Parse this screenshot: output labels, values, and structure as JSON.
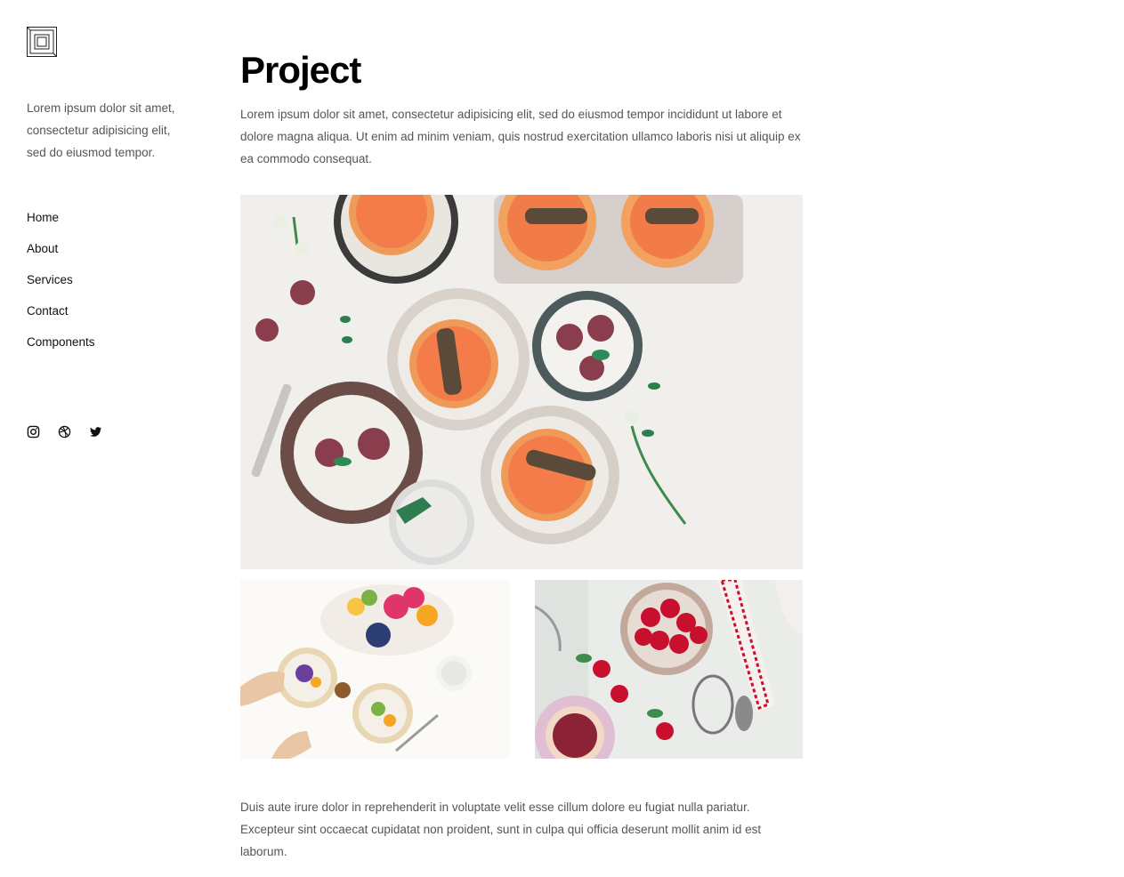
{
  "brand": {
    "logo_icon": "square-frame-logo-icon"
  },
  "sidebar": {
    "description": "Lorem ipsum dolor sit amet, consectetur adipisicing elit, sed do eiusmod tempor.",
    "nav": [
      {
        "label": "Home"
      },
      {
        "label": "About"
      },
      {
        "label": "Services"
      },
      {
        "label": "Contact"
      },
      {
        "label": "Components"
      }
    ],
    "social": [
      "instagram-icon",
      "dribbble-icon",
      "twitter-icon"
    ]
  },
  "main": {
    "title": "Project",
    "intro": "Lorem ipsum dolor sit amet, consectetur adipisicing elit, sed do eiusmod tempor incididunt ut labore et dolore magna aliqua. Ut enim ad minim veniam, quis nostrud exercitation ullamco laboris nisi ut aliquip ex ea commodo consequat.",
    "outro": "Duis aute irure dolor in reprehenderit in voluptate velit esse cillum dolore eu fugiat nulla pariatur. Excepteur sint occaecat cupidatat non proident, sunt in culpa qui officia deserunt mollit anim id est laborum."
  },
  "colors": {
    "text": "#1a1a1a",
    "muted": "#555555",
    "background": "#ffffff"
  }
}
